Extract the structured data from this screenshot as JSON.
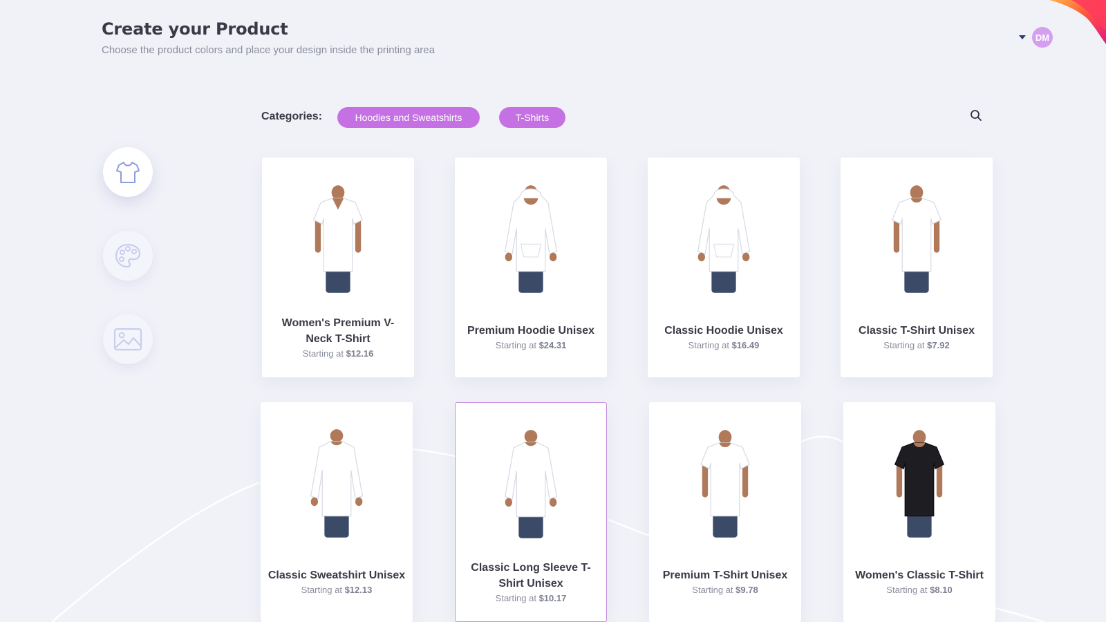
{
  "header": {
    "title": "Create your Product",
    "subtitle": "Choose the product colors and place your design inside the printing area"
  },
  "user": {
    "initials": "DM"
  },
  "tools": [
    {
      "icon": "tshirt-icon",
      "active": true
    },
    {
      "icon": "palette-icon",
      "active": false
    },
    {
      "icon": "image-icon",
      "active": false
    }
  ],
  "categories": {
    "label": "Categories:",
    "items": [
      "Hoodies and Sweatshirts",
      "T-Shirts"
    ]
  },
  "price_prefix": "Starting at",
  "products": [
    {
      "name": "Women's Premium V-Neck T-Shirt",
      "price": "$12.16",
      "garment": "vneck",
      "color": "#ffffff"
    },
    {
      "name": "Premium Hoodie Unisex",
      "price": "$24.31",
      "garment": "hoodie",
      "color": "#ffffff"
    },
    {
      "name": "Classic Hoodie Unisex",
      "price": "$16.49",
      "garment": "hoodie",
      "color": "#ffffff"
    },
    {
      "name": "Classic T-Shirt Unisex",
      "price": "$7.92",
      "garment": "tshirt",
      "color": "#ffffff"
    },
    {
      "name": "Classic Sweatshirt Unisex",
      "price": "$12.13",
      "garment": "sweatshirt",
      "color": "#ffffff"
    },
    {
      "name": "Classic Long Sleeve T-Shirt Unisex",
      "price": "$10.17",
      "garment": "longsleeve",
      "color": "#ffffff",
      "selected": true
    },
    {
      "name": "Premium T-Shirt Unisex",
      "price": "$9.78",
      "garment": "tshirt",
      "color": "#ffffff"
    },
    {
      "name": "Women's Classic T-Shirt",
      "price": "$8.10",
      "garment": "tshirt",
      "color": "#1d1d22"
    }
  ],
  "colors": {
    "accent": "#c571e3",
    "avatar": "#d59ff0",
    "background": "#f1f2f8"
  }
}
